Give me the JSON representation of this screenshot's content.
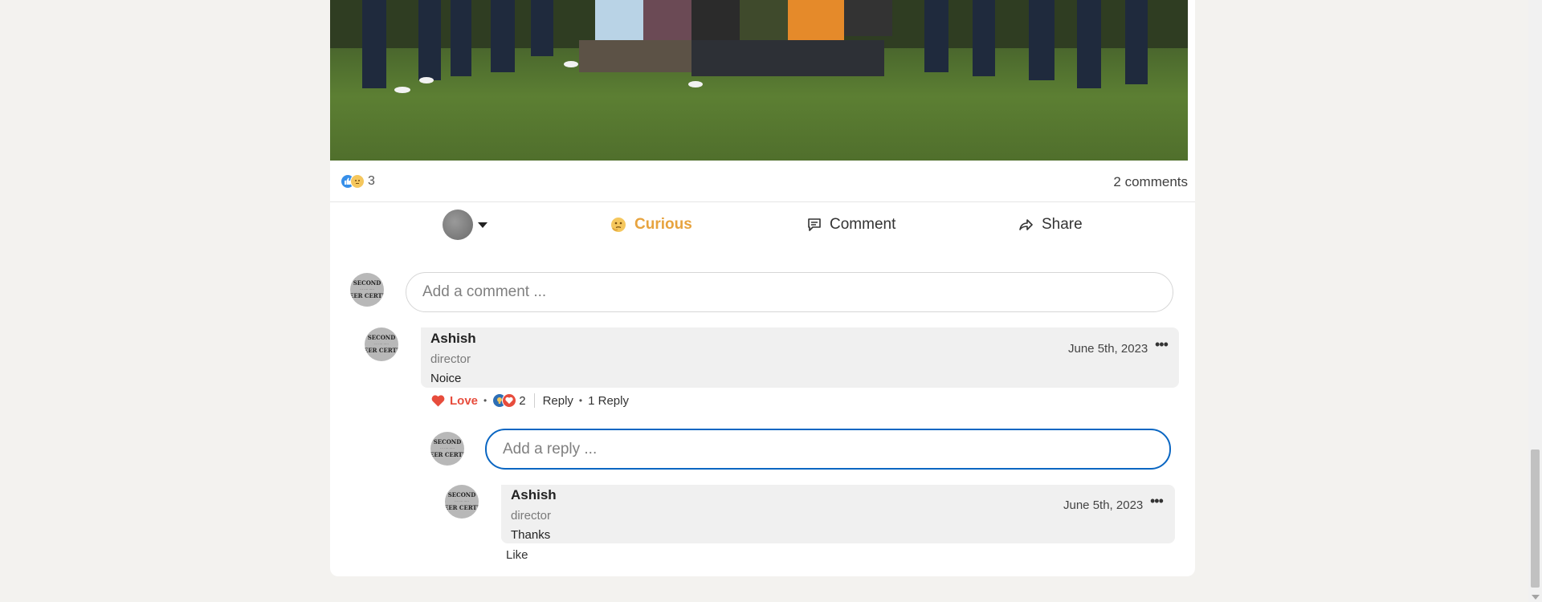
{
  "post": {
    "reactions_count": "3",
    "comments_count": "2 comments"
  },
  "actions": {
    "curious_label": "Curious",
    "comment_label": "Comment",
    "share_label": "Share"
  },
  "comment_box": {
    "placeholder": "Add a comment ..."
  },
  "avatar_text": {
    "line1": "SECOND",
    "line2": "EER CERTI"
  },
  "comments": [
    {
      "author": "Ashish",
      "headline": "director",
      "text": "Noice",
      "date": "June 5th, 2023",
      "reaction_label": "Love",
      "reactions_count": "2",
      "reply_label": "Reply",
      "replies_label": "1 Reply"
    }
  ],
  "reply_box": {
    "placeholder": "Add a reply ..."
  },
  "replies": [
    {
      "author": "Ashish",
      "headline": "director",
      "text": "Thanks",
      "date": "June 5th, 2023",
      "like_label": "Like"
    }
  ],
  "colors": {
    "page_bg": "#f3f2ef",
    "curious": "#e7a33e",
    "love": "#e74c3c",
    "focus": "#0a66c2"
  },
  "icons": {
    "like": "thumbs-up-icon",
    "curious": "thinking-face-icon",
    "comment": "speech-bubble-icon",
    "share": "share-arrow-icon",
    "love": "heart-icon",
    "more": "ellipsis-icon"
  }
}
